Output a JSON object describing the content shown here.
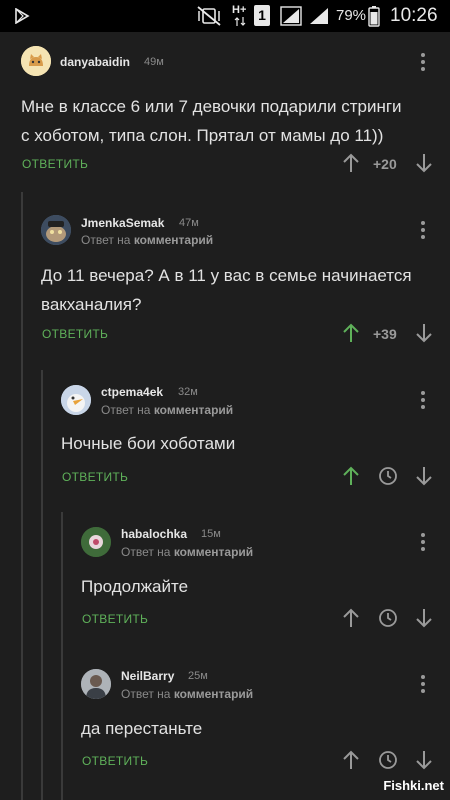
{
  "status_bar": {
    "network_label": "H+",
    "sim_label": "1",
    "battery_percent": "79%",
    "time": "10:26"
  },
  "comments": [
    {
      "username": "danyabaidin",
      "time": "49м",
      "reply_prefix": "",
      "reply_target": "",
      "text_lines": [
        "Мне в классе 6 или 7 девочки подарили стринги",
        "с хоботом, типа слон. Прятал от мамы до 11))"
      ],
      "reply_label": "ОТВЕТИТЬ",
      "score": "+20",
      "up_color": "#9a9a9a"
    },
    {
      "username": "JmenkaSemak",
      "time": "47м",
      "reply_prefix": "Ответ на",
      "reply_target": "комментарий",
      "text_lines": [
        "До 11 вечера? А в 11 у вас в семье начинается",
        "вакханалия?"
      ],
      "reply_label": "ОТВЕТИТЬ",
      "score": "+39",
      "up_color": "#5fb15a"
    },
    {
      "username": "ctpema4ek",
      "time": "32м",
      "reply_prefix": "Ответ на",
      "reply_target": "комментарий",
      "text_lines": [
        "Ночные бои хоботами"
      ],
      "reply_label": "ОТВЕТИТЬ",
      "score": "",
      "up_color": "#5fb15a"
    },
    {
      "username": "habalochka",
      "time": "15м",
      "reply_prefix": "Ответ на",
      "reply_target": "комментарий",
      "text_lines": [
        "Продолжайте"
      ],
      "reply_label": "ОТВЕТИТЬ",
      "score": "",
      "up_color": "#9a9a9a"
    },
    {
      "username": "NeilBarry",
      "time": "25м",
      "reply_prefix": "Ответ на",
      "reply_target": "комментарий",
      "text_lines": [
        "да перестаньте"
      ],
      "reply_label": "ОТВЕТИТЬ",
      "score": "",
      "up_color": "#9a9a9a"
    }
  ],
  "watermark": "Fishki.net",
  "colors": {
    "background": "#1e1e1e",
    "accent_green": "#5fb15a",
    "muted": "#9a9a9a"
  }
}
